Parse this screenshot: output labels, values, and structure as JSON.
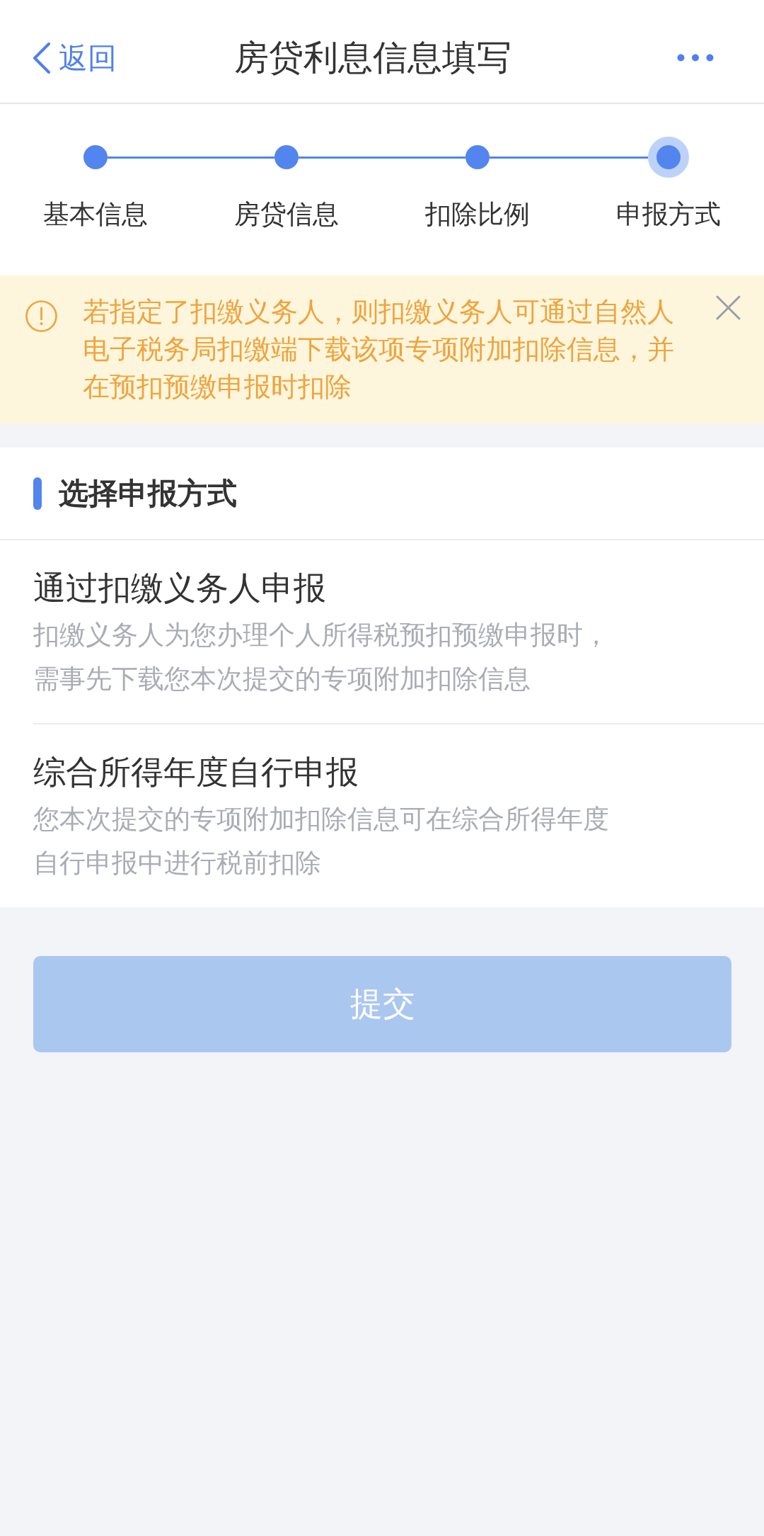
{
  "header": {
    "back_label": "返回",
    "title": "房贷利息信息填写"
  },
  "steps": [
    {
      "label": "基本信息",
      "selected": false
    },
    {
      "label": "房贷信息",
      "selected": false
    },
    {
      "label": "扣除比例",
      "selected": false
    },
    {
      "label": "申报方式",
      "selected": true
    }
  ],
  "notice": {
    "text": "若指定了扣缴义务人，则扣缴义务人可通过自然人电子税务局扣缴端下载该项专项附加扣除信息，并在预扣预缴申报时扣除"
  },
  "section": {
    "title": "选择申报方式",
    "options": [
      {
        "title": "通过扣缴义务人申报",
        "description": "扣缴义务人为您办理个人所得税预扣预缴申报时，需事先下载您本次提交的专项附加扣除信息"
      },
      {
        "title": "综合所得年度自行申报",
        "description": "您本次提交的专项附加扣除信息可在综合所得年度自行申报中进行税前扣除"
      }
    ]
  },
  "submit_button": {
    "label": "提交",
    "disabled": true
  }
}
